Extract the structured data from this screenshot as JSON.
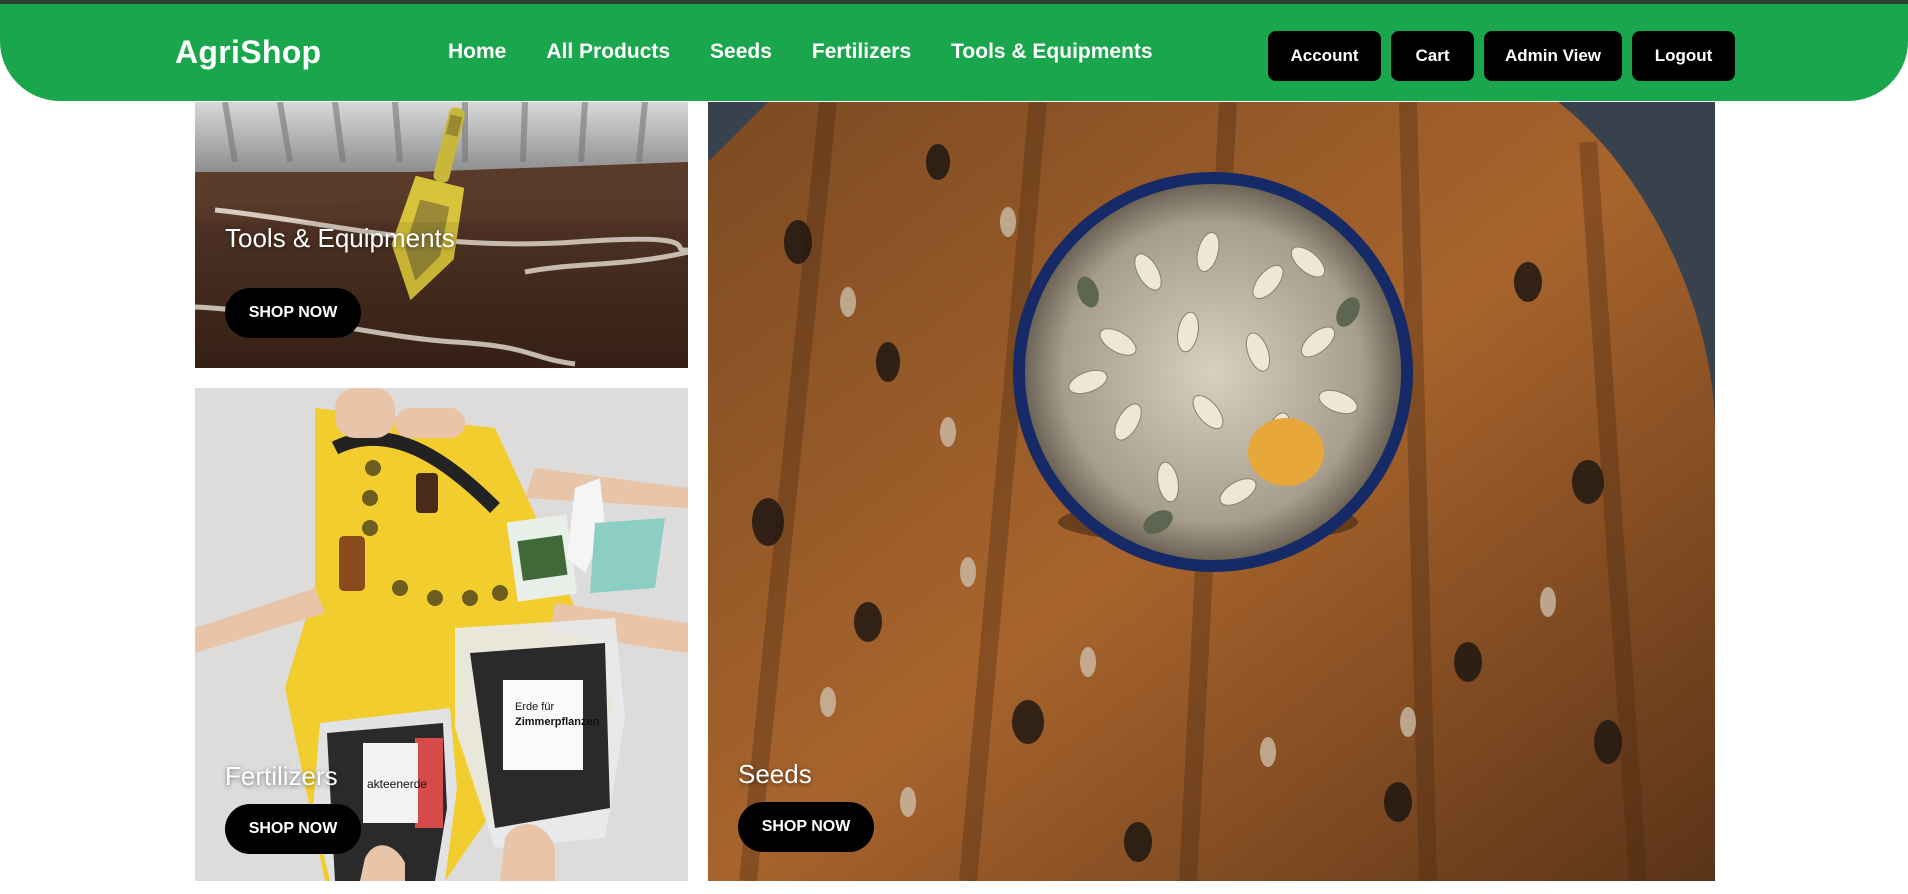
{
  "brand": {
    "name": "AgriShop",
    "accent_color": "#1aa64c"
  },
  "nav": {
    "links": [
      {
        "label": "Home"
      },
      {
        "label": "All Products"
      },
      {
        "label": "Seeds"
      },
      {
        "label": "Fertilizers"
      },
      {
        "label": "Tools & Equipments"
      }
    ],
    "actions": [
      {
        "label": "Account"
      },
      {
        "label": "Cart"
      },
      {
        "label": "Admin View"
      },
      {
        "label": "Logout"
      }
    ]
  },
  "categories": {
    "tools": {
      "title": "Tools & Equipments",
      "button": "SHOP NOW",
      "image": "trowel-in-soil-photo"
    },
    "fertilizers": {
      "title": "Fertilizers",
      "button": "SHOP NOW",
      "image": "potting-soil-bags-photo"
    },
    "seeds": {
      "title": "Seeds",
      "button": "SHOP NOW",
      "image": "sunflower-seeds-bowl-photo"
    }
  }
}
